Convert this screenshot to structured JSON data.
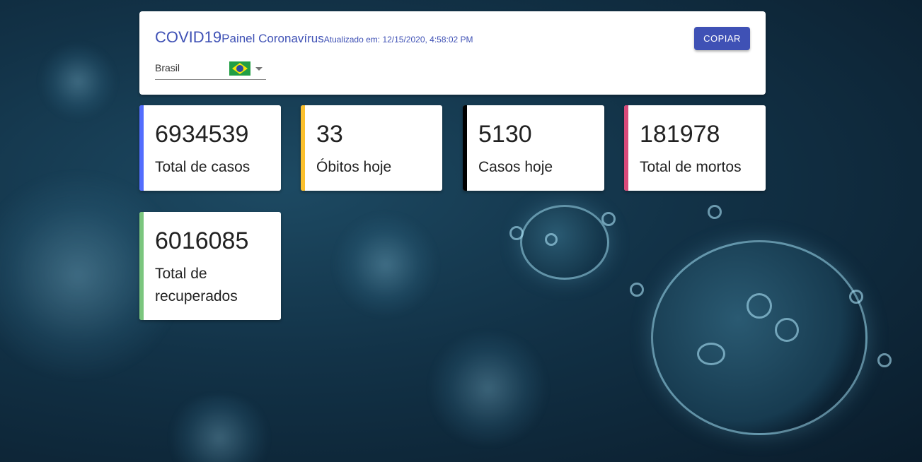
{
  "header": {
    "title": "COVID19",
    "subtitle": "Painel Coronavírus",
    "updated": "Atualizado em: 12/15/2020, 4:58:02 PM",
    "copy_label": "COPIAR"
  },
  "country": {
    "selected": "Brasil",
    "flag_icon": "brazil-flag-icon",
    "dropdown_icon": "caret-down-icon"
  },
  "stats": [
    {
      "value": "6934539",
      "label": "Total de casos",
      "color": "#536dfe"
    },
    {
      "value": "33",
      "label": "Óbitos hoje",
      "color": "#fbc02d"
    },
    {
      "value": "5130",
      "label": "Casos hoje",
      "color": "#000000"
    },
    {
      "value": "181978",
      "label": "Total de mortos",
      "color": "#d94a7a"
    },
    {
      "value": "6016085",
      "label": "Total de recuperados",
      "color": "#7bc67e"
    }
  ],
  "colors": {
    "primary": "#3f51b5",
    "background": "#123247"
  }
}
